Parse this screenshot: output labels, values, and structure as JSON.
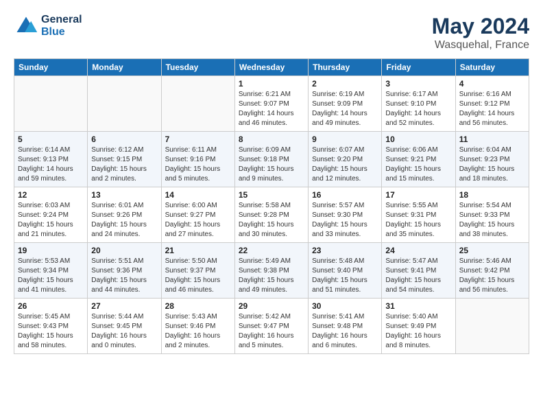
{
  "header": {
    "logo_line1": "General",
    "logo_line2": "Blue",
    "month": "May 2024",
    "location": "Wasquehal, France"
  },
  "weekdays": [
    "Sunday",
    "Monday",
    "Tuesday",
    "Wednesday",
    "Thursday",
    "Friday",
    "Saturday"
  ],
  "weeks": [
    [
      {
        "day": "",
        "empty": true
      },
      {
        "day": "",
        "empty": true
      },
      {
        "day": "",
        "empty": true
      },
      {
        "day": "1",
        "sunrise": "6:21 AM",
        "sunset": "9:07 PM",
        "daylight": "14 hours and 46 minutes."
      },
      {
        "day": "2",
        "sunrise": "6:19 AM",
        "sunset": "9:09 PM",
        "daylight": "14 hours and 49 minutes."
      },
      {
        "day": "3",
        "sunrise": "6:17 AM",
        "sunset": "9:10 PM",
        "daylight": "14 hours and 52 minutes."
      },
      {
        "day": "4",
        "sunrise": "6:16 AM",
        "sunset": "9:12 PM",
        "daylight": "14 hours and 56 minutes."
      }
    ],
    [
      {
        "day": "5",
        "sunrise": "6:14 AM",
        "sunset": "9:13 PM",
        "daylight": "14 hours and 59 minutes."
      },
      {
        "day": "6",
        "sunrise": "6:12 AM",
        "sunset": "9:15 PM",
        "daylight": "15 hours and 2 minutes."
      },
      {
        "day": "7",
        "sunrise": "6:11 AM",
        "sunset": "9:16 PM",
        "daylight": "15 hours and 5 minutes."
      },
      {
        "day": "8",
        "sunrise": "6:09 AM",
        "sunset": "9:18 PM",
        "daylight": "15 hours and 9 minutes."
      },
      {
        "day": "9",
        "sunrise": "6:07 AM",
        "sunset": "9:20 PM",
        "daylight": "15 hours and 12 minutes."
      },
      {
        "day": "10",
        "sunrise": "6:06 AM",
        "sunset": "9:21 PM",
        "daylight": "15 hours and 15 minutes."
      },
      {
        "day": "11",
        "sunrise": "6:04 AM",
        "sunset": "9:23 PM",
        "daylight": "15 hours and 18 minutes."
      }
    ],
    [
      {
        "day": "12",
        "sunrise": "6:03 AM",
        "sunset": "9:24 PM",
        "daylight": "15 hours and 21 minutes."
      },
      {
        "day": "13",
        "sunrise": "6:01 AM",
        "sunset": "9:26 PM",
        "daylight": "15 hours and 24 minutes."
      },
      {
        "day": "14",
        "sunrise": "6:00 AM",
        "sunset": "9:27 PM",
        "daylight": "15 hours and 27 minutes."
      },
      {
        "day": "15",
        "sunrise": "5:58 AM",
        "sunset": "9:28 PM",
        "daylight": "15 hours and 30 minutes."
      },
      {
        "day": "16",
        "sunrise": "5:57 AM",
        "sunset": "9:30 PM",
        "daylight": "15 hours and 33 minutes."
      },
      {
        "day": "17",
        "sunrise": "5:55 AM",
        "sunset": "9:31 PM",
        "daylight": "15 hours and 35 minutes."
      },
      {
        "day": "18",
        "sunrise": "5:54 AM",
        "sunset": "9:33 PM",
        "daylight": "15 hours and 38 minutes."
      }
    ],
    [
      {
        "day": "19",
        "sunrise": "5:53 AM",
        "sunset": "9:34 PM",
        "daylight": "15 hours and 41 minutes."
      },
      {
        "day": "20",
        "sunrise": "5:51 AM",
        "sunset": "9:36 PM",
        "daylight": "15 hours and 44 minutes."
      },
      {
        "day": "21",
        "sunrise": "5:50 AM",
        "sunset": "9:37 PM",
        "daylight": "15 hours and 46 minutes."
      },
      {
        "day": "22",
        "sunrise": "5:49 AM",
        "sunset": "9:38 PM",
        "daylight": "15 hours and 49 minutes."
      },
      {
        "day": "23",
        "sunrise": "5:48 AM",
        "sunset": "9:40 PM",
        "daylight": "15 hours and 51 minutes."
      },
      {
        "day": "24",
        "sunrise": "5:47 AM",
        "sunset": "9:41 PM",
        "daylight": "15 hours and 54 minutes."
      },
      {
        "day": "25",
        "sunrise": "5:46 AM",
        "sunset": "9:42 PM",
        "daylight": "15 hours and 56 minutes."
      }
    ],
    [
      {
        "day": "26",
        "sunrise": "5:45 AM",
        "sunset": "9:43 PM",
        "daylight": "15 hours and 58 minutes."
      },
      {
        "day": "27",
        "sunrise": "5:44 AM",
        "sunset": "9:45 PM",
        "daylight": "16 hours and 0 minutes."
      },
      {
        "day": "28",
        "sunrise": "5:43 AM",
        "sunset": "9:46 PM",
        "daylight": "16 hours and 2 minutes."
      },
      {
        "day": "29",
        "sunrise": "5:42 AM",
        "sunset": "9:47 PM",
        "daylight": "16 hours and 5 minutes."
      },
      {
        "day": "30",
        "sunrise": "5:41 AM",
        "sunset": "9:48 PM",
        "daylight": "16 hours and 6 minutes."
      },
      {
        "day": "31",
        "sunrise": "5:40 AM",
        "sunset": "9:49 PM",
        "daylight": "16 hours and 8 minutes."
      },
      {
        "day": "",
        "empty": true
      }
    ]
  ]
}
